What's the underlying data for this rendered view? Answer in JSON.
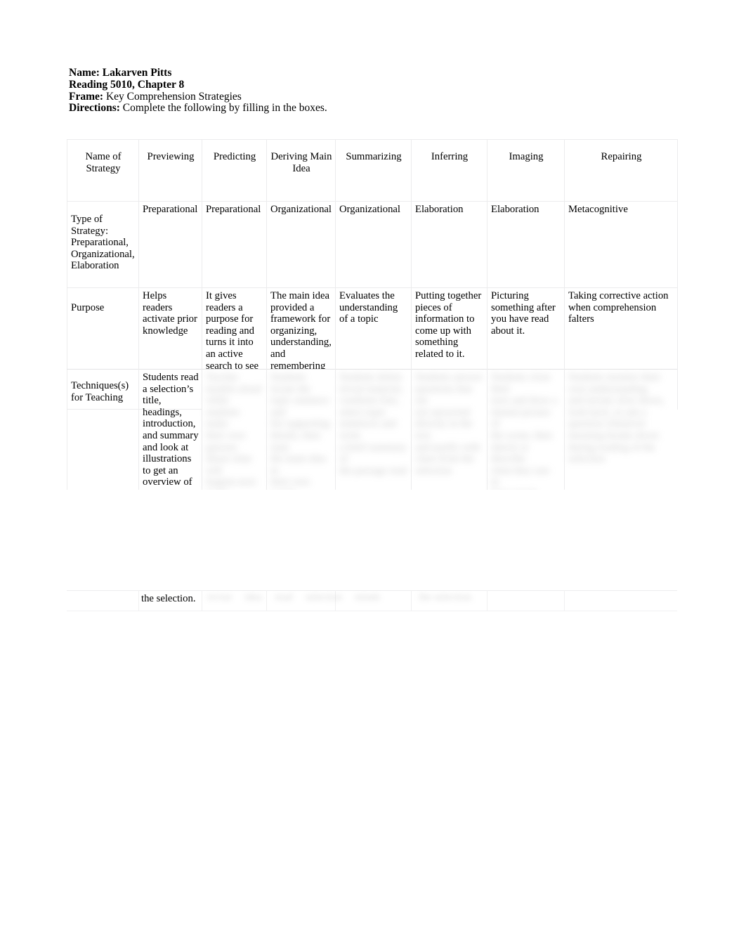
{
  "document": {
    "header": {
      "name_label": "Name:",
      "name_value": " Lakarven Pitts",
      "course_line": "Reading 5010, Chapter 8",
      "frame_label": "Frame:",
      "frame_value": " Key Comprehension Strategies",
      "directions_label": "Directions:",
      "directions_value": " Complete the following by filling in the boxes."
    },
    "table": {
      "row_headers": {
        "strategy": "Name of\nStrategy",
        "type": "Type of Strategy: Preparational, Organizational, Elaboration",
        "purpose": "Purpose",
        "techniques": "Techniques(s) for Teaching"
      },
      "columns": [
        "Previewing",
        "Predicting",
        "Deriving Main Idea",
        "Summarizing",
        "Inferring",
        "Imaging",
        "Repairing"
      ],
      "type_of_strategy": [
        "Preparational",
        "Preparational",
        "Organizational",
        "Organizational",
        "Elaboration",
        "Elaboration",
        "Metacognitive"
      ],
      "purpose": [
        "Helps readers activate prior knowledge",
        "It gives readers a purpose for reading and turns it into an active search to see if their prediction is correct.",
        "The main idea provided a framework for organizing, understanding, and remembering the essential details.",
        "Evaluates the understanding of a topic",
        "Putting together pieces of information to come up with something related to it.",
        "Picturing something after you have read about it.",
        "Taking corrective action when comprehension falters"
      ],
      "techniques": [
        "Students read a selection’s title, headings, introduction, and summary and look at illustrations to get an overview of",
        "",
        "",
        "",
        "",
        "",
        ""
      ],
      "techniques_tail": "the selection."
    }
  },
  "colors": {
    "page_background": "#ffffff",
    "text": "#000000",
    "table_border": "#ececed",
    "redaction_blur": "#9b9b9b"
  }
}
